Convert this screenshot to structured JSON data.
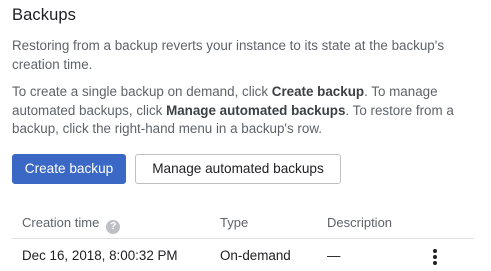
{
  "title": "Backups",
  "intro": "Restoring from a backup reverts your instance to its state at the backup's creation time.",
  "instructions": {
    "part1": "To create a single backup on demand, click ",
    "create_ref": "Create backup",
    "part2": ". To manage automated backups, click ",
    "manage_ref": "Manage automated backups",
    "part3": ". To restore from a backup, click the right-hand menu in a backup's row."
  },
  "buttons": {
    "create": "Create backup",
    "manage": "Manage automated backups"
  },
  "table": {
    "headers": {
      "creation_time": "Creation time",
      "type": "Type",
      "description": "Description"
    },
    "help_glyph": "?",
    "rows": [
      {
        "creation_time": "Dec 16, 2018, 8:00:32 PM",
        "type": "On-demand",
        "description": "—"
      }
    ]
  },
  "icons": {
    "help": "help-icon",
    "row_menu": "more-vert-icon"
  },
  "colors": {
    "primary_button": "#3b68c5",
    "text": "#202124",
    "muted_text": "#5f6368",
    "divider": "#e0e0e0"
  }
}
